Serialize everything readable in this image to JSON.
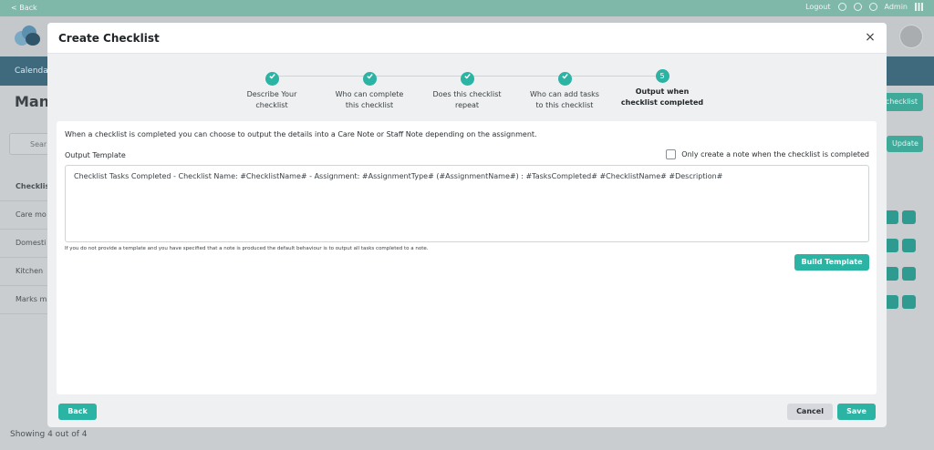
{
  "background": {
    "topbar": {
      "back": "< Back",
      "logout": "Logout",
      "admin": "Admin"
    },
    "nav_item": "Calenda",
    "page_title": "Mana",
    "top_button": "checklist",
    "search_placeholder": "Sear",
    "update_button": "Update",
    "list": [
      "Checklis",
      "Care mo",
      "Domesti",
      "Kitchen",
      "Marks m"
    ],
    "footer": "Showing 4 out of 4"
  },
  "modal": {
    "title": "Create Checklist",
    "close": "×",
    "steps": [
      {
        "number": "1",
        "label_line1": "Describe Your",
        "label_line2": "checklist",
        "done": true
      },
      {
        "number": "2",
        "label_line1": "Who can complete",
        "label_line2": "this checklist",
        "done": true
      },
      {
        "number": "3",
        "label_line1": "Does this checklist",
        "label_line2": "repeat",
        "done": true
      },
      {
        "number": "4",
        "label_line1": "Who can add tasks",
        "label_line2": "to this checklist",
        "done": true
      },
      {
        "number": "5",
        "label_line1": "Output when",
        "label_line2": "checklist completed",
        "done": false
      }
    ],
    "description": "When a checklist is completed you can choose to output the details into a Care Note or Staff Note depending on the assignment.",
    "output_template_label": "Output Template",
    "only_create_label": "Only create a note when the checklist is completed",
    "template_value": "Checklist Tasks Completed - Checklist Name: #ChecklistName# - Assignment: #AssignmentType# (#AssignmentName#) : #TasksCompleted# #ChecklistName# #Description#",
    "note": "If you do not provide a template and you have specified that a note is produced the default behaviour is to output all tasks completed to a note.",
    "build_template": "Build Template",
    "back": "Back",
    "cancel": "Cancel",
    "save": "Save"
  },
  "colors": {
    "accent": "#2bb3a4",
    "nav": "#3f6a7e",
    "topbar": "#7fb7a8"
  }
}
